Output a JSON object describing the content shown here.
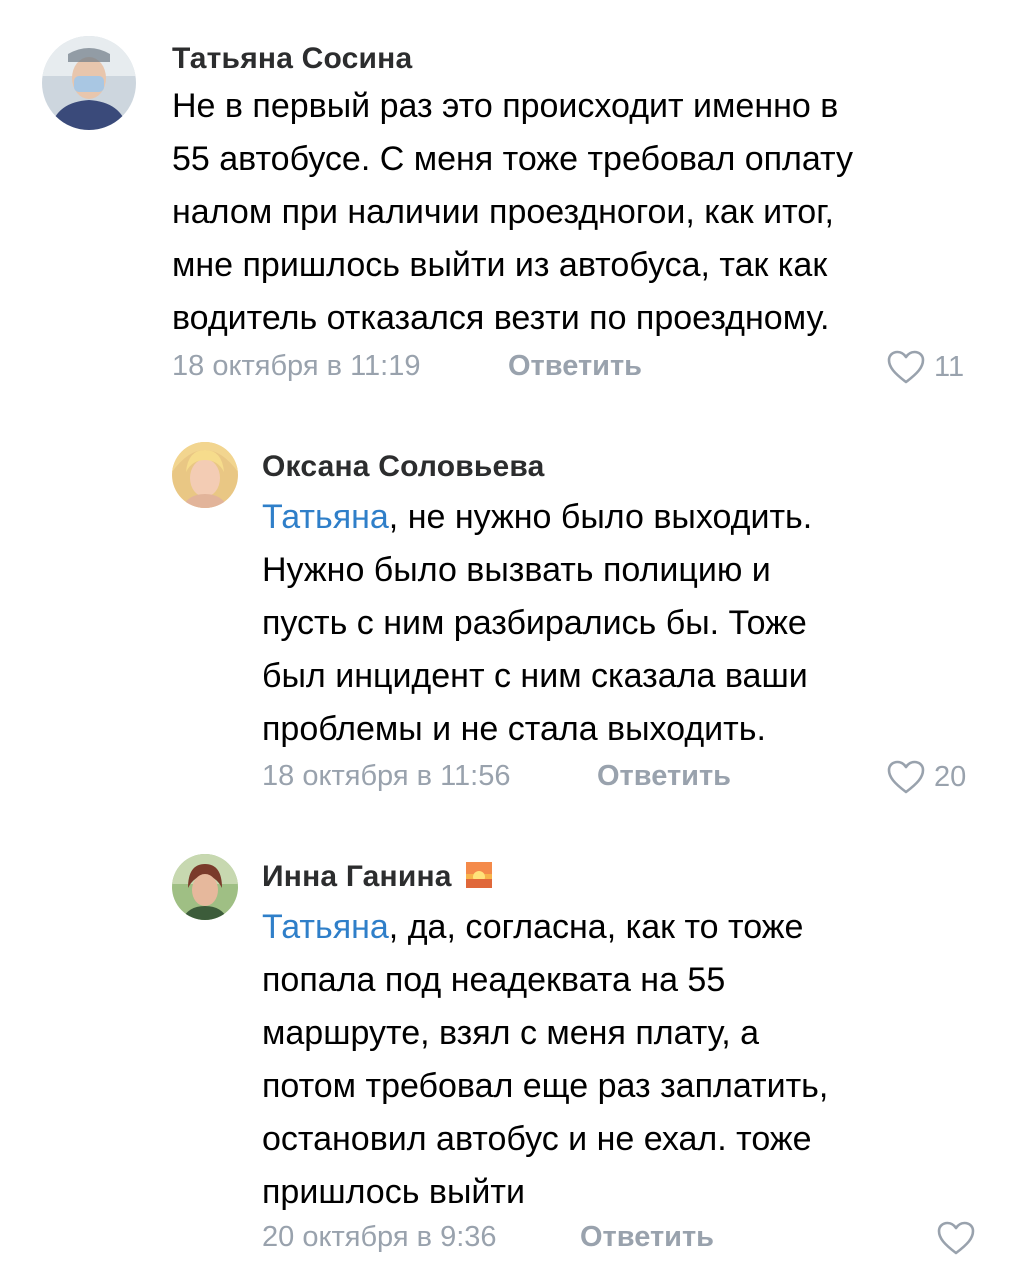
{
  "comments": [
    {
      "author": "Татьяна Сосина",
      "mention": "",
      "lines": [
        "Не в первый раз это происходит именно в",
        "55 автобусе. С меня тоже требовал оплату",
        "налом при наличии проездногои, как итог,",
        "мне пришлось выйти из автобуса, так как",
        "водитель отказался везти по проездному."
      ],
      "date": "18 октября в 11:19",
      "reply_label": "Ответить",
      "likes": "11"
    },
    {
      "author": "Оксана Соловьева",
      "mention": "Татьяна",
      "lines": [
        ", не нужно было выходить.",
        "Нужно было вызвать полицию и",
        "пусть с ним разбирались бы. Тоже",
        "был инцидент с ним сказала ваши",
        "проблемы и не стала выходить."
      ],
      "date": "18 октября в 11:56",
      "reply_label": "Ответить",
      "likes": "20"
    },
    {
      "author": "Инна Ганина",
      "author_emoji": "sunset-emoji",
      "mention": "Татьяна",
      "lines": [
        ", да, согласна, как то тоже",
        "попала под неадеквата на 55",
        "маршруте, взял с меня плату, а",
        "потом требовал еще раз заплатить,",
        "остановил автобус и не ехал. тоже",
        "пришлось выйти"
      ],
      "date": "20 октября в 9:36",
      "reply_label": "Ответить",
      "likes": ""
    }
  ],
  "colors": {
    "mention": "#2f7fc9",
    "meta": "#99a2ad",
    "author": "#2c2d2e"
  },
  "icons": {
    "like": "heart-outline-icon"
  }
}
